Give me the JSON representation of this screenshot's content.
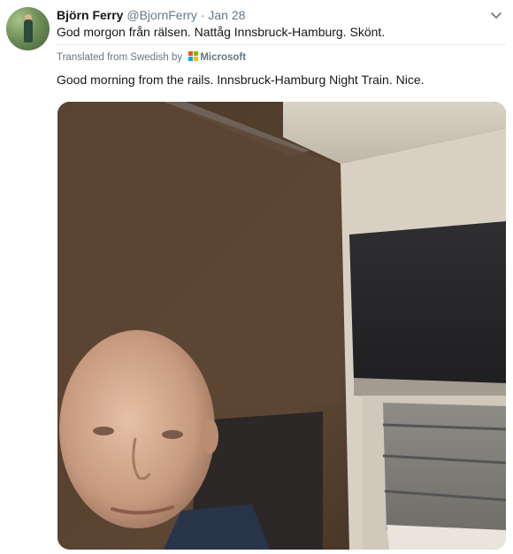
{
  "tweet": {
    "display_name": "Björn Ferry",
    "handle": "@BjornFerry",
    "separator": "·",
    "date": "Jan 28",
    "text": "God morgon från rälsen. Nattåg Innsbruck-Hamburg. Skönt.",
    "translated_label": "Translated from Swedish by",
    "translator_name": "Microsoft",
    "translation": "Good morning from the rails. Innsbruck-Hamburg Night Train. Nice."
  },
  "icons": {
    "caret": "chevron-down-icon",
    "translator_logo": "microsoft-logo"
  },
  "colors": {
    "name": "#14171a",
    "muted": "#657786",
    "divider": "#e6ecf0"
  }
}
